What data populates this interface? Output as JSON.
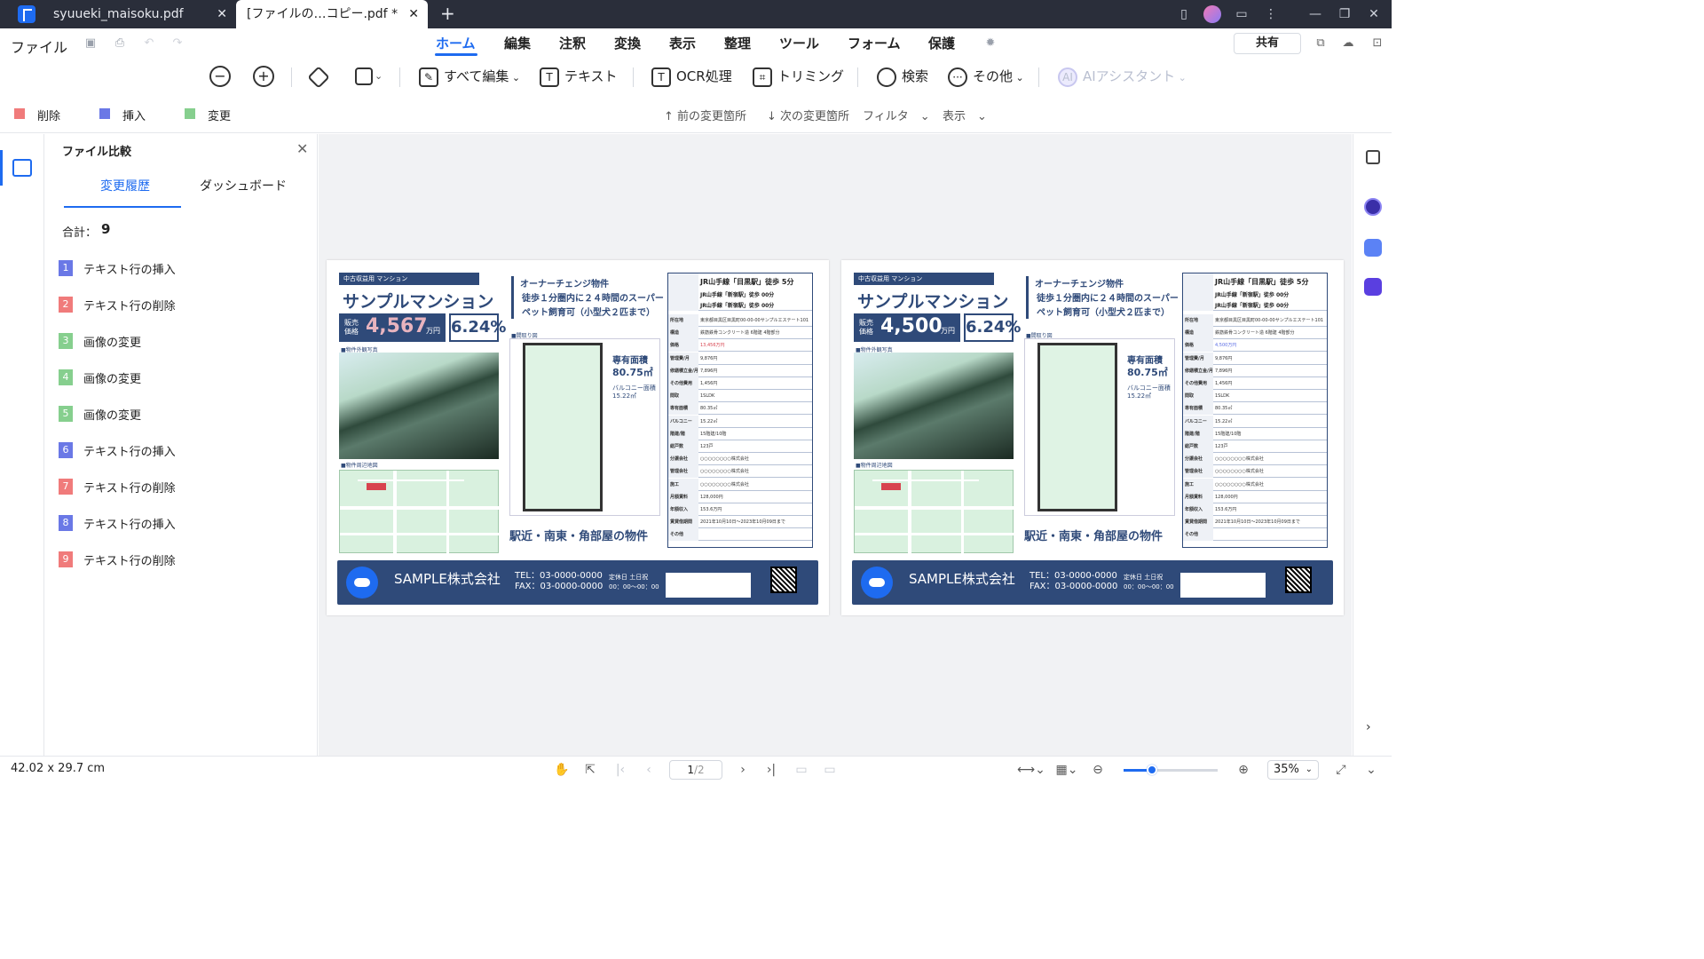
{
  "window": {
    "tabs": [
      {
        "label": "syuueki_maisoku.pdf",
        "active": false
      },
      {
        "label": "[ファイルの…コピー.pdf *",
        "active": true
      }
    ],
    "new_tab": "+"
  },
  "menubar": {
    "file_label": "ファイル",
    "items": [
      "ホーム",
      "編集",
      "注釈",
      "変換",
      "表示",
      "整理",
      "ツール",
      "フォーム",
      "保護"
    ],
    "active_item": "ホーム",
    "share_label": "共有"
  },
  "toolbar": {
    "edit_all": "すべて編集",
    "text": "テキスト",
    "ocr": "OCR処理",
    "crop": "トリミング",
    "search": "検索",
    "more": "その他",
    "ai_assistant": "AIアシスタント",
    "ai_badge": "AI"
  },
  "legend": {
    "items": [
      {
        "label": "削除",
        "color": "#f07b7b"
      },
      {
        "label": "挿入",
        "color": "#6a78e6"
      },
      {
        "label": "変更",
        "color": "#86cf8e"
      }
    ],
    "prev_change": "前の変更箇所",
    "next_change": "次の変更箇所",
    "filter": "フィルタ",
    "display": "表示"
  },
  "panel": {
    "title": "ファイル比較",
    "tabs": [
      "変更履歴",
      "ダッシュボード"
    ],
    "total_label": "合計：",
    "total_value": "9",
    "changes": [
      {
        "num": "1",
        "label": "テキスト行の挿入",
        "color": "#6a78e6"
      },
      {
        "num": "2",
        "label": "テキスト行の削除",
        "color": "#f07b7b"
      },
      {
        "num": "3",
        "label": "画像の変更",
        "color": "#86cf8e"
      },
      {
        "num": "4",
        "label": "画像の変更",
        "color": "#86cf8e"
      },
      {
        "num": "5",
        "label": "画像の変更",
        "color": "#86cf8e"
      },
      {
        "num": "6",
        "label": "テキスト行の挿入",
        "color": "#6a78e6"
      },
      {
        "num": "7",
        "label": "テキスト行の削除",
        "color": "#f07b7b"
      },
      {
        "num": "8",
        "label": "テキスト行の挿入",
        "color": "#6a78e6"
      },
      {
        "num": "9",
        "label": "テキスト行の削除",
        "color": "#f07b7b"
      }
    ]
  },
  "pages": [
    {
      "header": "中古収益用 マンション",
      "title": "サンプルマンション",
      "price_label": "販売 価格",
      "price": "4,567",
      "price_unit": "万円",
      "yield": "6.24%",
      "photo_caption": "■物件外観写真",
      "map_caption": "■物件周辺地図",
      "owner_change": "オーナーチェンジ物件",
      "desc": "徒歩１分圏内に２４時間のスーパー ペット飼育可（小型犬２匹まで）",
      "floor_caption": "■間取り図",
      "area_label": "専有面積",
      "area_value": "80.75㎡",
      "balcony": "バルコニー面積 15.22㎡",
      "feature": "駅近・南東・角部屋の物件",
      "station_main": "JR山手線「目黒駅」徒歩 5分",
      "station_sub1": "JR山手線「新宿駅」徒歩 00分",
      "station_sub2": "JR山手線「新宿駅」徒歩 00分",
      "table": [
        [
          "所在地",
          "東京都目黒区目黒町00-00-00サンプルエステート101"
        ],
        [
          "構造",
          "鉄筋鉄骨コンクリート造 6階建 4階部分"
        ],
        [
          "価格",
          "13,456万円"
        ],
        [
          "管理費/月",
          "9,876円"
        ],
        [
          "修繕積立金/月",
          "7,896円"
        ],
        [
          "その他費用",
          "1,456円"
        ],
        [
          "間取",
          "1SLDK"
        ],
        [
          "専有面積",
          "80.35㎡"
        ],
        [
          "バルコニー",
          "15.22㎡"
        ],
        [
          "階建/階",
          "15階建/10階"
        ],
        [
          "総戸数",
          "123戸"
        ],
        [
          "分譲会社",
          "○○○○○○○○株式会社"
        ],
        [
          "管理会社",
          "○○○○○○○○株式会社"
        ],
        [
          "施工",
          "○○○○○○○○株式会社"
        ],
        [
          "月額賃料",
          "128,000円"
        ],
        [
          "年額収入",
          "153.6万円"
        ],
        [
          "賃貸借期間",
          "2021年10月10日〜2023年10月09日まで"
        ],
        [
          "その他",
          ""
        ]
      ],
      "company": "SAMPLE株式会社",
      "tel": "TEL：03-0000-0000",
      "fax": "FAX：03-0000-0000",
      "hours": "定休日 土日祝 00：00〜00：00"
    },
    {
      "header": "中古収益用 マンション",
      "title": "サンプルマンション",
      "price_label": "販売 価格",
      "price": "4,500",
      "price_unit": "万円",
      "yield": "6.24%",
      "photo_caption": "■物件外観写真",
      "map_caption": "■物件周辺地図",
      "owner_change": "オーナーチェンジ物件",
      "desc": "徒歩１分圏内に２４時間のスーパー ペット飼育可（小型犬２匹まで）",
      "floor_caption": "■間取り図",
      "area_label": "専有面積",
      "area_value": "80.75㎡",
      "balcony": "バルコニー面積 15.22㎡",
      "feature": "駅近・南東・角部屋の物件",
      "station_main": "JR山手線「目黒駅」徒歩 5分",
      "station_sub1": "JR山手線「新宿駅」徒歩 00分",
      "station_sub2": "JR山手線「新宿駅」徒歩 00分",
      "table": [
        [
          "所在地",
          "東京都目黒区目黒町00-00-00サンプルエステート101"
        ],
        [
          "構造",
          "鉄筋鉄骨コンクリート造 6階建 4階部分"
        ],
        [
          "価格",
          "4,500万円"
        ],
        [
          "管理費/月",
          "9,876円"
        ],
        [
          "修繕積立金/月",
          "7,896円"
        ],
        [
          "その他費用",
          "1,456円"
        ],
        [
          "間取",
          "1SLDK"
        ],
        [
          "専有面積",
          "80.35㎡"
        ],
        [
          "バルコニー",
          "15.22㎡"
        ],
        [
          "階建/階",
          "15階建/10階"
        ],
        [
          "総戸数",
          "123戸"
        ],
        [
          "分譲会社",
          "○○○○○○○○株式会社"
        ],
        [
          "管理会社",
          "○○○○○○○○株式会社"
        ],
        [
          "施工",
          "○○○○○○○○株式会社"
        ],
        [
          "月額賃料",
          "128,000円"
        ],
        [
          "年額収入",
          "153.6万円"
        ],
        [
          "賃貸借期間",
          "2021年10月10日〜2023年10月09日まで"
        ],
        [
          "その他",
          ""
        ]
      ],
      "company": "SAMPLE株式会社",
      "tel": "TEL：03-0000-0000",
      "fax": "FAX：03-0000-0000",
      "hours": "定休日 土日祝 00：00〜00：00"
    }
  ],
  "status": {
    "page_size": "42.02 x 29.7 cm",
    "current_page": "1",
    "total_pages": "/2",
    "zoom": "35%",
    "zoom_fraction": 0.3
  }
}
